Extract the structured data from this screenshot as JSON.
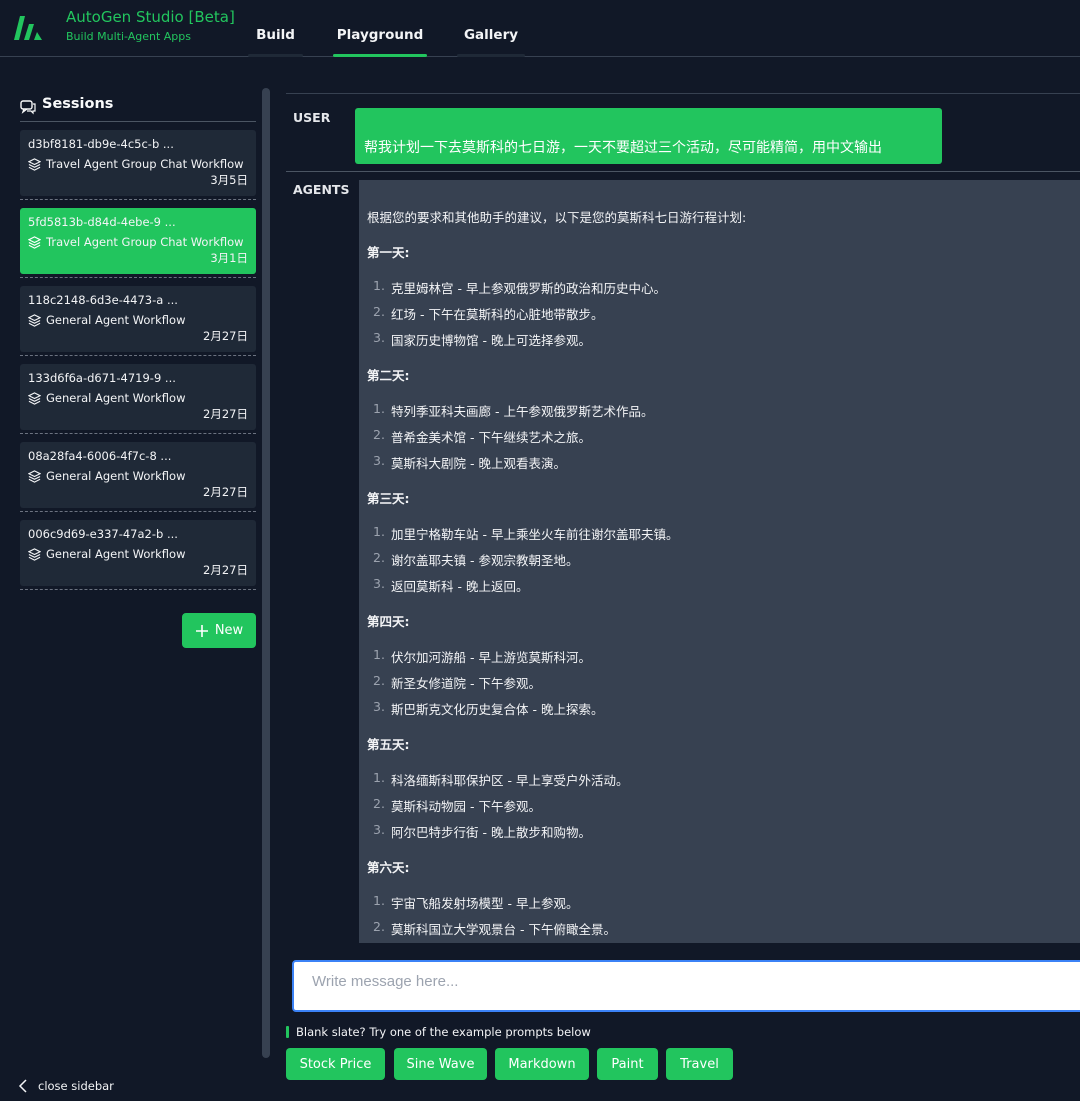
{
  "header": {
    "title": "AutoGen Studio [Beta]",
    "subtitle": "Build Multi-Agent Apps",
    "tabs": [
      {
        "label": "Build"
      },
      {
        "label": "Playground"
      },
      {
        "label": "Gallery"
      }
    ],
    "accent_color": "#22c55e"
  },
  "sidebar": {
    "heading": "Sessions",
    "sessions": [
      {
        "id": "d3bf8181-db9e-4c5c-b ...",
        "workflow": "Travel Agent Group Chat Workflow",
        "date": "3月5日"
      },
      {
        "id": "5fd5813b-d84d-4ebe-9 ...",
        "workflow": "Travel Agent Group Chat Workflow",
        "date": "3月1日"
      },
      {
        "id": "118c2148-6d3e-4473-a ...",
        "workflow": "General Agent Workflow",
        "date": "2月27日"
      },
      {
        "id": "133d6f6a-d671-4719-9 ...",
        "workflow": "General Agent Workflow",
        "date": "2月27日"
      },
      {
        "id": "08a28fa4-6006-4f7c-8 ...",
        "workflow": "General Agent Workflow",
        "date": "2月27日"
      },
      {
        "id": "006c9d69-e337-47a2-b ...",
        "workflow": "General Agent Workflow",
        "date": "2月27日"
      }
    ],
    "new_label": "New",
    "close_label": "close sidebar"
  },
  "chat": {
    "user_label": "USER",
    "user_message": "帮我计划一下去莫斯科的七日游，一天不要超过三个活动，尽可能精简，用中文输出",
    "agents_label": "AGENTS",
    "agent_intro": "根据您的要求和其他助手的建议，以下是您的莫斯科七日游行程计划:",
    "days": [
      {
        "title": "第一天:",
        "activities": [
          "克里姆林宫 - 早上参观俄罗斯的政治和历史中心。",
          "红场 - 下午在莫斯科的心脏地带散步。",
          "国家历史博物馆 - 晚上可选择参观。"
        ]
      },
      {
        "title": "第二天:",
        "activities": [
          "特列季亚科夫画廊 - 上午参观俄罗斯艺术作品。",
          "普希金美术馆 - 下午继续艺术之旅。",
          "莫斯科大剧院 - 晚上观看表演。"
        ]
      },
      {
        "title": "第三天:",
        "activities": [
          "加里宁格勒车站 - 早上乘坐火车前往谢尔盖耶夫镇。",
          "谢尔盖耶夫镇 - 参观宗教朝圣地。",
          "返回莫斯科 - 晚上返回。"
        ]
      },
      {
        "title": "第四天:",
        "activities": [
          "伏尔加河游船 - 早上游览莫斯科河。",
          "新圣女修道院 - 下午参观。",
          "斯巴斯克文化历史复合体 - 晚上探索。"
        ]
      },
      {
        "title": "第五天:",
        "activities": [
          "科洛缅斯科耶保护区 - 早上享受户外活动。",
          "莫斯科动物园 - 下午参观。",
          "阿尔巴特步行街 - 晚上散步和购物。"
        ]
      },
      {
        "title": "第六天:",
        "activities": [
          "宇宙飞船发射场模型 - 早上参观。",
          "莫斯科国立大学观景台 - 下午俯瞰全景。"
        ]
      }
    ]
  },
  "composer": {
    "placeholder": "Write message here...",
    "hint": "Blank slate? Try one of the example prompts below",
    "prompts": [
      "Stock Price",
      "Sine Wave",
      "Markdown",
      "Paint",
      "Travel"
    ]
  }
}
